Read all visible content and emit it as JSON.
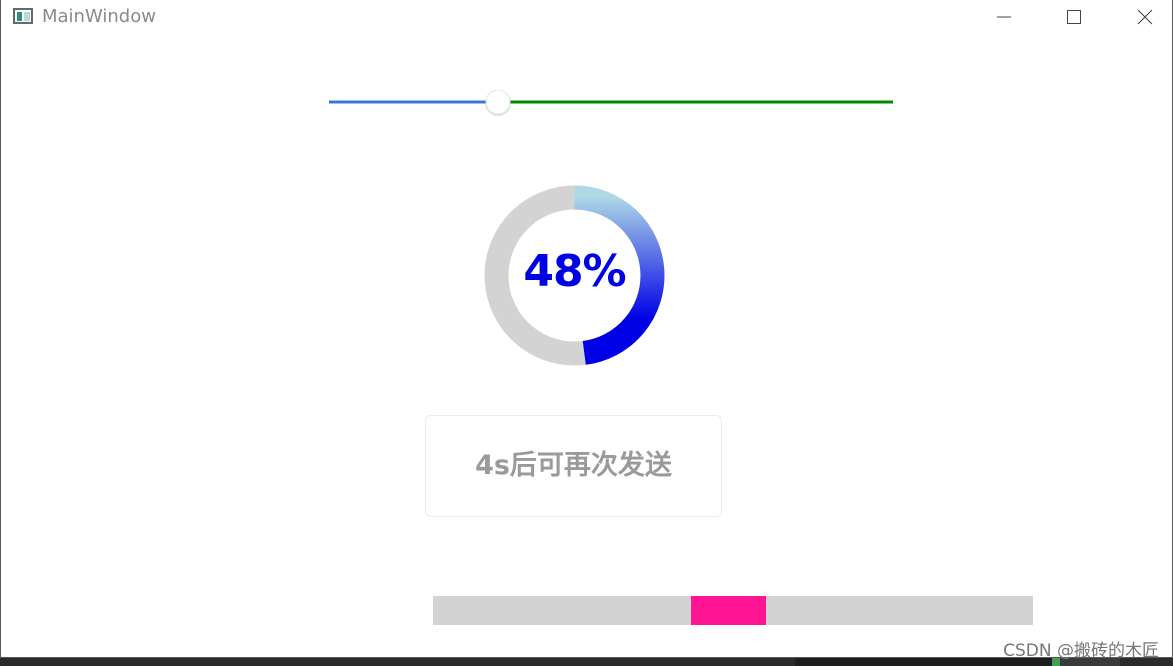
{
  "window": {
    "title": "MainWindow",
    "icons": {
      "app": "app-window-icon",
      "minimize": "minimize-icon",
      "maximize": "maximize-icon",
      "close": "close-icon"
    }
  },
  "slider": {
    "value": 0.3,
    "colors": {
      "left": "#3a74d9",
      "right": "#008a00",
      "thumb": "#ffffff"
    }
  },
  "progress_ring": {
    "label": "48%",
    "value": 48,
    "colors": {
      "track": "#d3d3d3",
      "gradient_start": "#add8e6",
      "gradient_end": "#0000e6",
      "text": "#0000e6"
    }
  },
  "send_button": {
    "label": "4s后可再次发送",
    "text_color": "#9a9a9a"
  },
  "loading_bar": {
    "indicator_start": 0.43,
    "indicator_length": 0.125,
    "colors": {
      "track": "#d3d3d3",
      "indicator": "#ff1493"
    }
  },
  "watermark": {
    "text": "CSDN @搬砖的木匠"
  }
}
